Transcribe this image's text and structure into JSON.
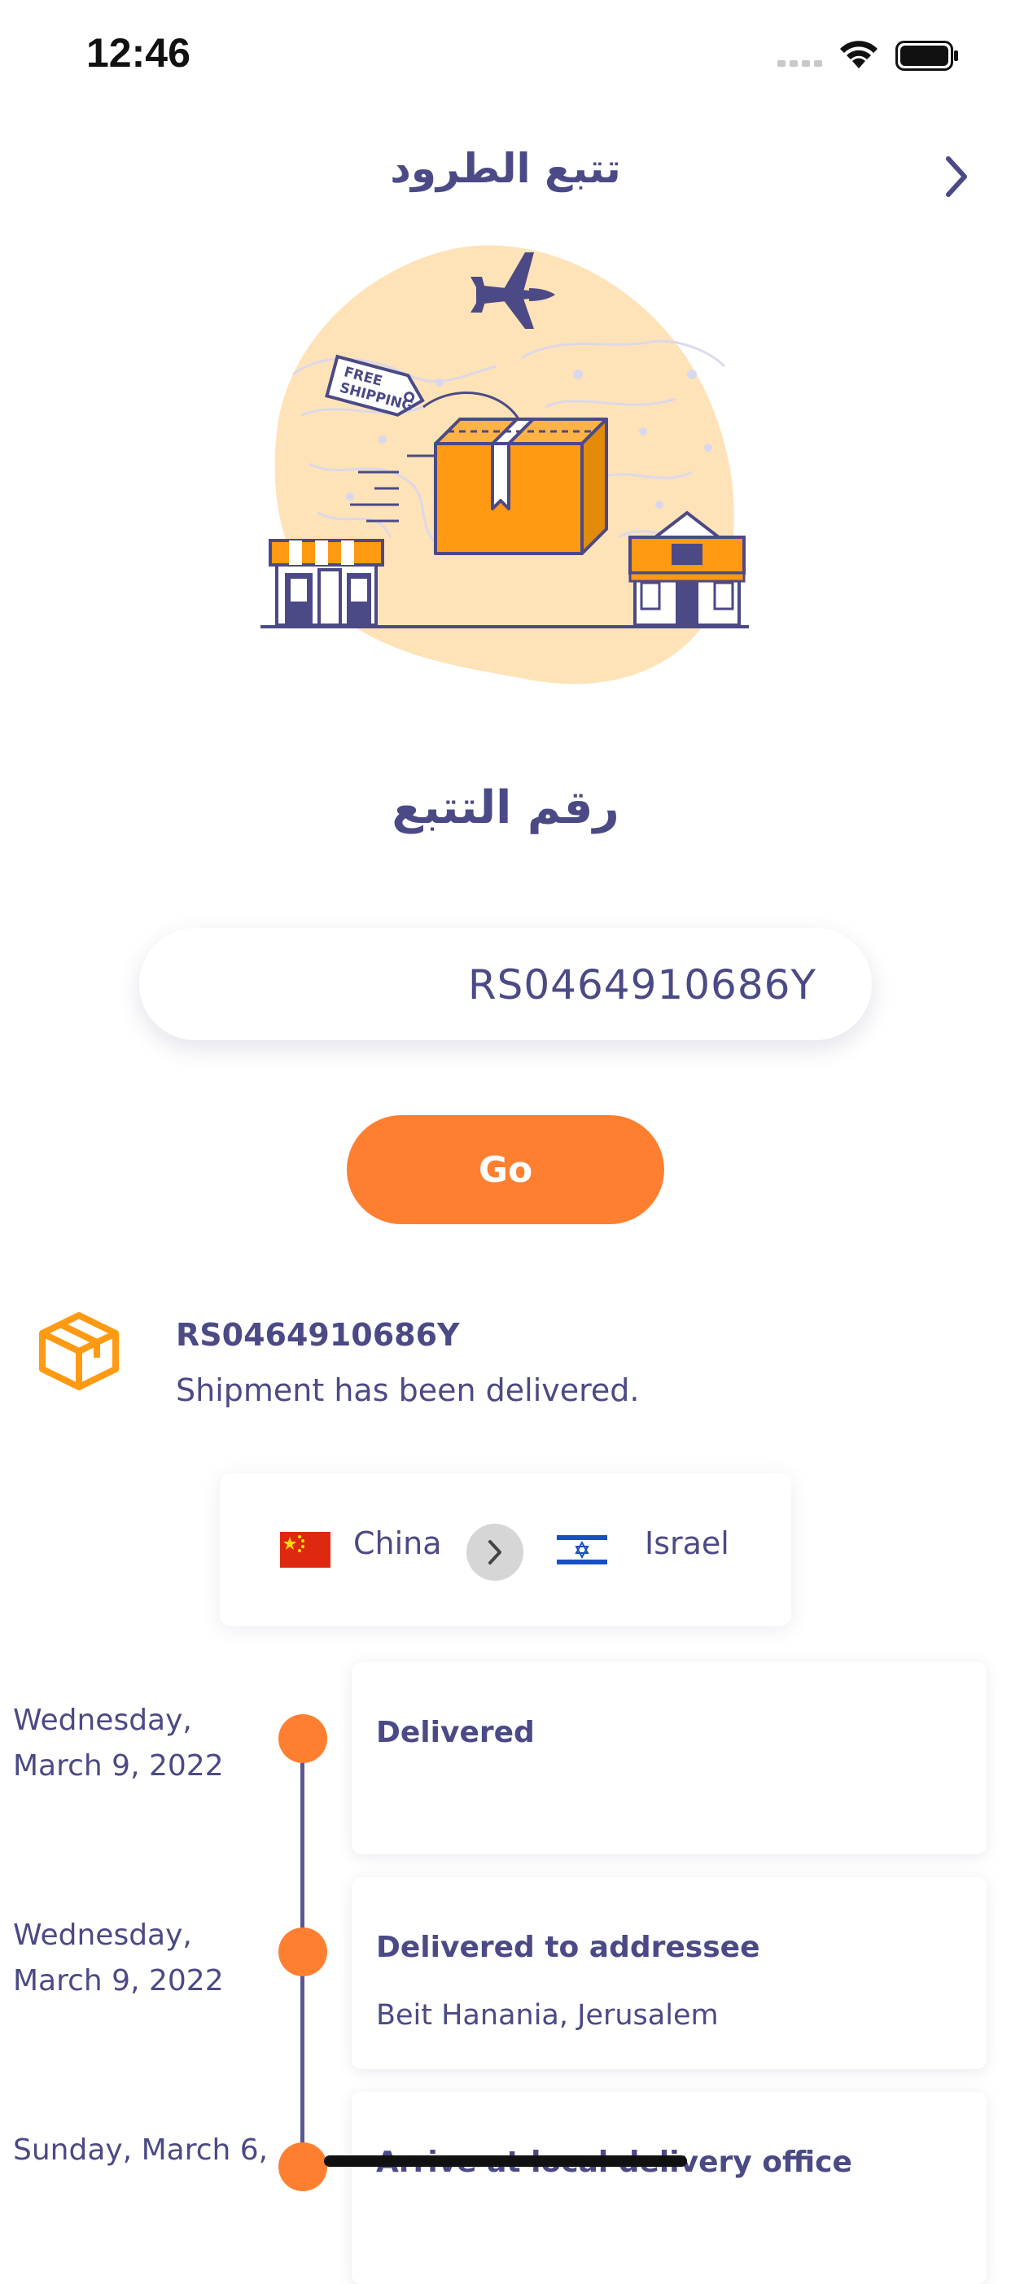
{
  "status_bar": {
    "time": "12:46"
  },
  "header": {
    "title": "تتبع الطرود",
    "back_icon": "chevron-right-icon"
  },
  "illustration": {
    "tag_text_line1": "FREE",
    "tag_text_line2": "SHIPPING"
  },
  "form": {
    "label": "رقم التتبع",
    "tracking_value": "RS0464910686Y",
    "go_label": "Go"
  },
  "result": {
    "icon": "package-box-icon",
    "tracking_number": "RS0464910686Y",
    "status": "Shipment has been delivered."
  },
  "route": {
    "origin": "China",
    "destination": "Israel",
    "arrow_icon": "chevron-right-icon"
  },
  "events": [
    {
      "date": "Wednesday, March 9, 2022",
      "title": "Delivered",
      "location": ""
    },
    {
      "date": "Wednesday, March 9, 2022",
      "title": "Delivered to addressee",
      "location": "Beit Hanania, Jerusalem"
    },
    {
      "date": "Sunday, March 6,",
      "title": "Arrive at local delivery office",
      "location": ""
    }
  ],
  "colors": {
    "primary_text": "#4b4a86",
    "accent_orange": "#ff7f30",
    "box_orange": "#ff9a12",
    "blob": "#ffe3b8"
  }
}
